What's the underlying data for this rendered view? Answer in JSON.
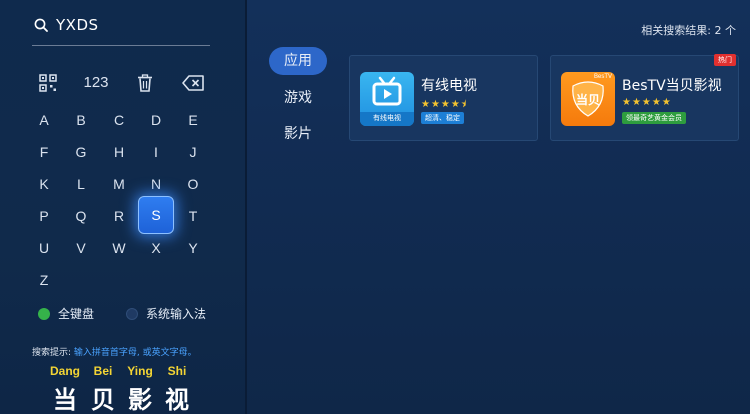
{
  "search": {
    "query": "YXDS"
  },
  "keyboard": {
    "tool_keys": [
      {
        "name": "qr-code-icon",
        "label": ""
      },
      {
        "name": "numbers-key",
        "label": "123"
      },
      {
        "name": "trash-icon",
        "label": ""
      },
      {
        "name": "backspace-icon",
        "label": ""
      }
    ],
    "rows": [
      [
        "A",
        "B",
        "C",
        "D",
        "E"
      ],
      [
        "F",
        "G",
        "H",
        "I",
        "J"
      ],
      [
        "K",
        "L",
        "M",
        "N",
        "O"
      ],
      [
        "P",
        "Q",
        "R",
        "S",
        "T"
      ],
      [
        "U",
        "V",
        "W",
        "X",
        "Y"
      ],
      [
        "Z"
      ]
    ],
    "active_key": "S"
  },
  "input_modes": {
    "full": "全键盘",
    "system": "系统输入法"
  },
  "hint": {
    "label": "搜索提示:",
    "value": "输入拼音首字母, 或英文字母。"
  },
  "brand": [
    {
      "pinyin": "Dang",
      "char": "当"
    },
    {
      "pinyin": "Bei",
      "char": "贝"
    },
    {
      "pinyin": "Ying",
      "char": "影"
    },
    {
      "pinyin": "Shi",
      "char": "视"
    }
  ],
  "results_count": "相关搜索结果: 2 个",
  "tabs": [
    {
      "label": "应用",
      "active": true
    },
    {
      "label": "游戏",
      "active": false
    },
    {
      "label": "影片",
      "active": false
    }
  ],
  "apps": [
    {
      "name": "有线电视",
      "rating": 4.5,
      "stars": "★★★★⯨",
      "tag": "超清、稳定",
      "tag_color": "#1d7fd6",
      "icon": "tv-app-icon",
      "icon_caption": "有线电视",
      "hot": ""
    },
    {
      "name": "BesTV当贝影视",
      "rating": 5,
      "stars": "★★★★★",
      "tag": "领最奇艺黄金会员",
      "tag_color": "#2e9d3e",
      "icon": "dangbei-app-icon",
      "icon_caption": "当贝",
      "icon_corner": "BesTV",
      "hot": "热门"
    }
  ],
  "colors": {
    "accent_blue": "#2d67c9",
    "star": "#f2c230",
    "pinyin_yellow": "#f4d534",
    "hot_red": "#e1302f"
  }
}
